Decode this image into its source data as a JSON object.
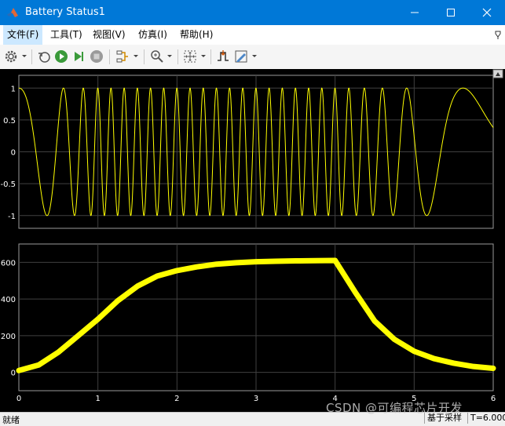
{
  "window": {
    "title": "Battery Status1"
  },
  "menu": {
    "items": [
      "文件(F)",
      "工具(T)",
      "视图(V)",
      "仿真(I)",
      "帮助(H)"
    ]
  },
  "toolbar": {
    "icons": [
      "gear-icon",
      "restore-icon",
      "run-icon",
      "step-forward-icon",
      "stop-icon",
      "signal-selector-icon",
      "zoom-in-icon",
      "fit-to-view-icon",
      "trigger-icon",
      "style-icon"
    ]
  },
  "colors": {
    "signal": "#ffff00",
    "plot_bg": "#000000",
    "grid": "#404040",
    "axis_text": "#ffffff",
    "title_bar": "#0078d7"
  },
  "status": {
    "left": "就绪",
    "mode": "基于采样",
    "time": "T=6.000"
  },
  "watermark": "CSDN @可编程芯片开发",
  "chart_data": [
    {
      "type": "line",
      "title": "",
      "xlabel": "",
      "ylabel": "",
      "xlim": [
        0,
        6
      ],
      "ylim": [
        -1.2,
        1.2
      ],
      "x_ticks": [
        "0",
        "1",
        "2",
        "3",
        "4",
        "5",
        "6"
      ],
      "y_ticks": [
        "1",
        "0.5",
        "0",
        "-0.5",
        "-1"
      ],
      "y_tick_values": [
        1,
        0.5,
        0,
        -0.5,
        -1
      ],
      "grid": true,
      "series": [
        {
          "description_free": true,
          "signal": "cos(2πf(t)·t) chirp",
          "x": [
            0,
            0.5,
            0.75,
            1,
            2,
            3,
            4,
            4.6,
            5,
            5.5,
            6
          ],
          "instantaneous_freq_hz": [
            0.8,
            2.5,
            4.5,
            6,
            6,
            6,
            6,
            4,
            2,
            0.8,
            0.3
          ]
        }
      ]
    },
    {
      "type": "line",
      "title": "",
      "xlabel": "",
      "ylabel": "",
      "xlim": [
        0,
        6
      ],
      "ylim": [
        -100,
        700
      ],
      "x_ticks": [
        "0",
        "1",
        "2",
        "3",
        "4",
        "5",
        "6"
      ],
      "y_ticks": [
        "600",
        "400",
        "200",
        "0"
      ],
      "y_tick_values": [
        600,
        400,
        200,
        0
      ],
      "grid": true,
      "series": [
        {
          "x": [
            0,
            0.25,
            0.5,
            0.75,
            1,
            1.25,
            1.5,
            1.75,
            2,
            2.25,
            2.5,
            2.75,
            3,
            3.25,
            3.5,
            3.75,
            4,
            4.25,
            4.5,
            4.75,
            5,
            5.25,
            5.5,
            5.75,
            6
          ],
          "y": [
            10,
            40,
            110,
            200,
            290,
            390,
            470,
            525,
            555,
            575,
            590,
            598,
            603,
            606,
            608,
            609,
            610,
            440,
            280,
            180,
            115,
            75,
            50,
            32,
            22
          ]
        }
      ]
    }
  ]
}
